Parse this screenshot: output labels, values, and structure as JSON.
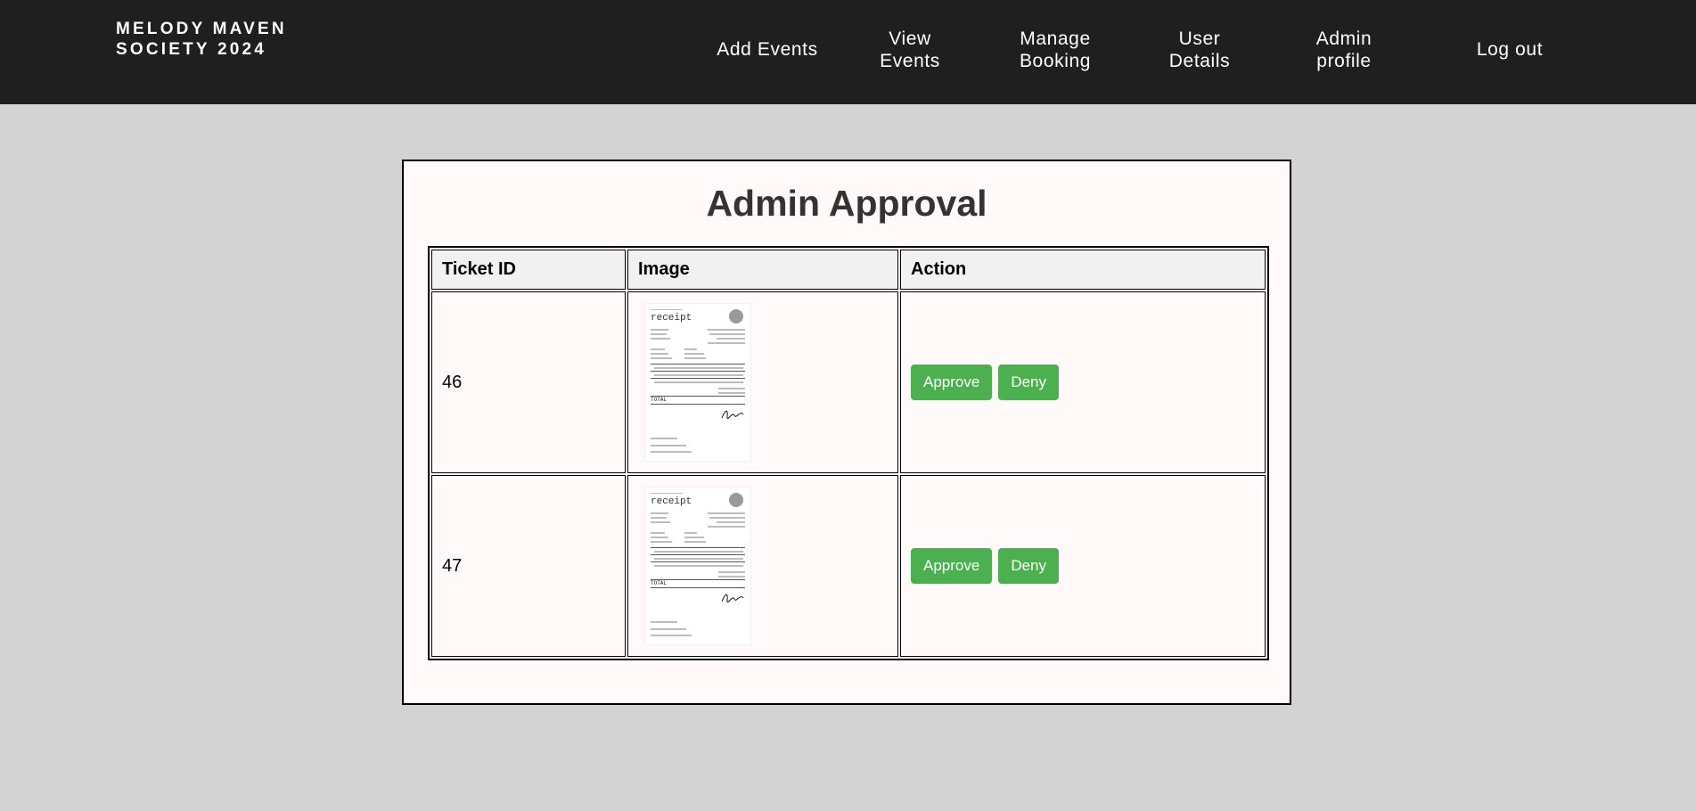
{
  "brand": {
    "title": "MELODY MAVEN SOCIETY 2024"
  },
  "nav": {
    "add_events": "Add Events",
    "view_events": "View Events",
    "manage_booking": "Manage Booking",
    "user_details": "User Details",
    "admin_profile": "Admin profile",
    "log_out": "Log out"
  },
  "page": {
    "title": "Admin Approval"
  },
  "table": {
    "headers": {
      "ticket_id": "Ticket ID",
      "image": "Image",
      "action": "Action"
    },
    "rows": [
      {
        "ticket_id": "46",
        "approve_label": "Approve",
        "deny_label": "Deny"
      },
      {
        "ticket_id": "47",
        "approve_label": "Approve",
        "deny_label": "Deny"
      }
    ]
  },
  "receipt_image": {
    "heading": "receipt",
    "total": "TOTAL"
  },
  "colors": {
    "navbar": "#1f1f1f",
    "background": "#d3d3d3",
    "card": "#fffaf9",
    "button": "#4caf50"
  }
}
